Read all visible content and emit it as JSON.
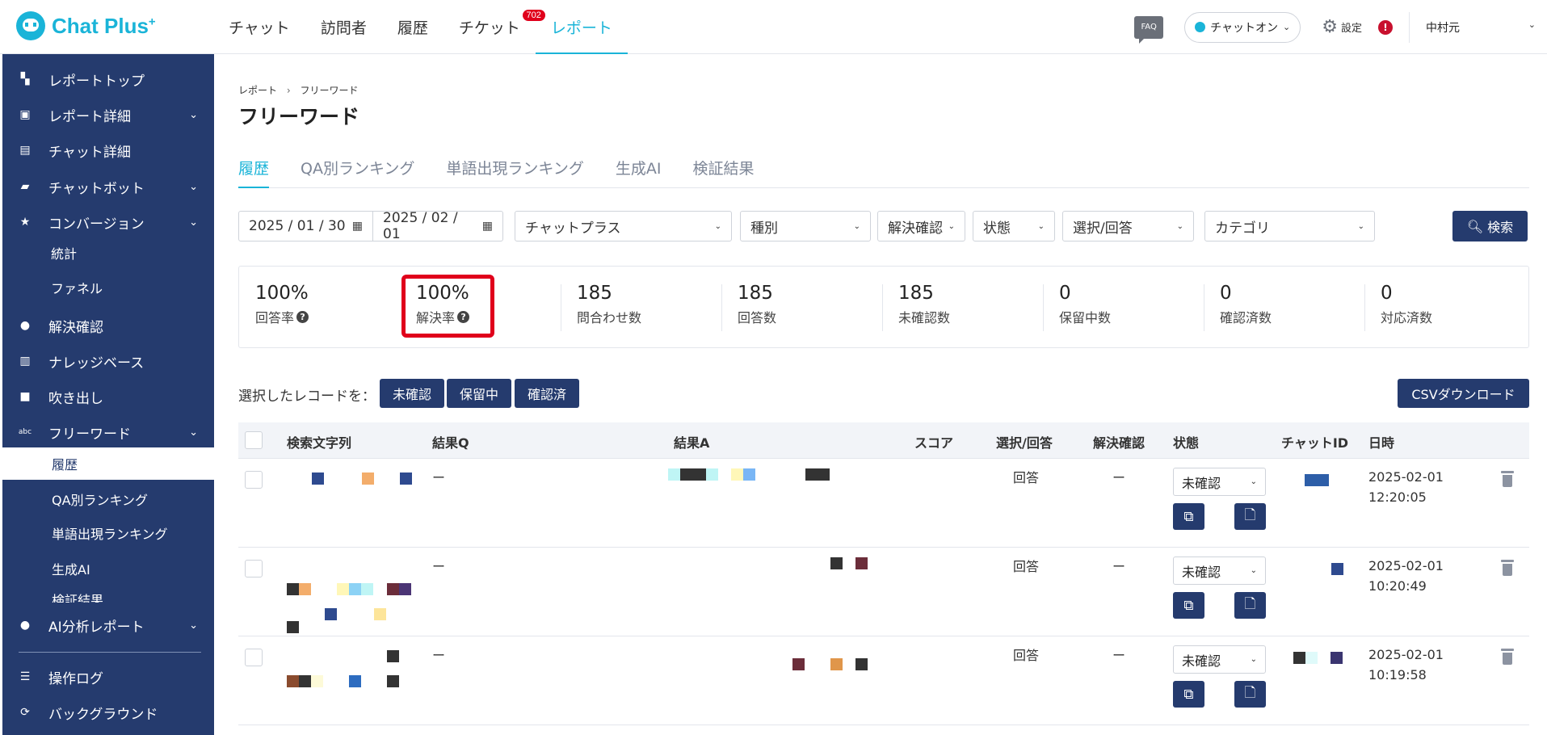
{
  "brand": {
    "name": "Chat Plus",
    "sup": "+"
  },
  "topnav": [
    {
      "label": "チャット"
    },
    {
      "label": "訪問者"
    },
    {
      "label": "履歴"
    },
    {
      "label": "チケット",
      "badge": "702"
    },
    {
      "label": "レポート",
      "active": true
    }
  ],
  "header_right": {
    "faq": "FAQ",
    "status": "チャットオン",
    "settings": "設定",
    "alert": "!",
    "user": "中村元"
  },
  "sidebar": {
    "items": [
      {
        "label": "レポートトップ",
        "icon": "dashboard-icon"
      },
      {
        "label": "レポート詳細",
        "icon": "chart-icon",
        "expandable": true
      },
      {
        "label": "チャット詳細",
        "icon": "chat-icon"
      },
      {
        "label": "チャットボット",
        "icon": "bot-icon",
        "expandable": true
      },
      {
        "label": "コンバージョン",
        "icon": "star-icon",
        "expandable": true
      },
      {
        "label": "解決確認",
        "icon": "bulb-icon"
      },
      {
        "label": "ナレッジベース",
        "icon": "book-icon"
      },
      {
        "label": "吹き出し",
        "icon": "bubble-icon"
      },
      {
        "label": "フリーワード",
        "icon": "abc-icon",
        "expandable": true
      },
      {
        "label": "AI分析レポート",
        "icon": "bulb-icon",
        "expandable": true
      },
      {
        "label": "操作ログ",
        "icon": "list-icon"
      },
      {
        "label": "バックグラウンド",
        "icon": "refresh-icon"
      }
    ],
    "conversion_sub": [
      "統計",
      "ファネル"
    ],
    "freeword_sub": [
      "履歴",
      "QA別ランキング",
      "単語出現ランキング",
      "生成AI",
      "検証結果"
    ]
  },
  "breadcrumb": {
    "parent": "レポート",
    "sep": "›",
    "current": "フリーワード"
  },
  "page_title": "フリーワード",
  "tabs": [
    "履歴",
    "QA別ランキング",
    "単語出現ランキング",
    "生成AI",
    "検証結果"
  ],
  "filters": {
    "date_from": "2025 / 01 / 30",
    "date_to": "2025 / 02 / 01",
    "site": "チャットプラス",
    "type": "種別",
    "resolution": "解決確認",
    "state": "状態",
    "select_answer": "選択/回答",
    "category": "カテゴリ",
    "search": "検索"
  },
  "stats": [
    {
      "value": "100%",
      "label": "回答率",
      "help": true
    },
    {
      "value": "100%",
      "label": "解決率",
      "help": true
    },
    {
      "value": "185",
      "label": "問合わせ数"
    },
    {
      "value": "185",
      "label": "回答数"
    },
    {
      "value": "185",
      "label": "未確認数"
    },
    {
      "value": "0",
      "label": "保留中数"
    },
    {
      "value": "0",
      "label": "確認済数"
    },
    {
      "value": "0",
      "label": "対応済数"
    }
  ],
  "bulk": {
    "label": "選択したレコードを：",
    "buttons": [
      "未確認",
      "保留中",
      "確認済"
    ],
    "csv": "CSVダウンロード"
  },
  "table": {
    "headers": [
      "検索文字列",
      "結果Q",
      "結果A",
      "スコア",
      "選択/回答",
      "解決確認",
      "状態",
      "チャットID",
      "日時"
    ],
    "rows": [
      {
        "result_q": "ー",
        "select_answer": "回答",
        "resolution": "ー",
        "status": "未確認",
        "date": "2025-02-01",
        "time": "12:20:05"
      },
      {
        "result_q": "ー",
        "select_answer": "回答",
        "resolution": "ー",
        "status": "未確認",
        "date": "2025-02-01",
        "time": "10:20:49"
      },
      {
        "result_q": "ー",
        "select_answer": "回答",
        "resolution": "ー",
        "status": "未確認",
        "date": "2025-02-01",
        "time": "10:19:58"
      }
    ]
  },
  "colors": {
    "navy": "#253b6e",
    "accent": "#1ab4d8",
    "alert": "#e0001b"
  }
}
